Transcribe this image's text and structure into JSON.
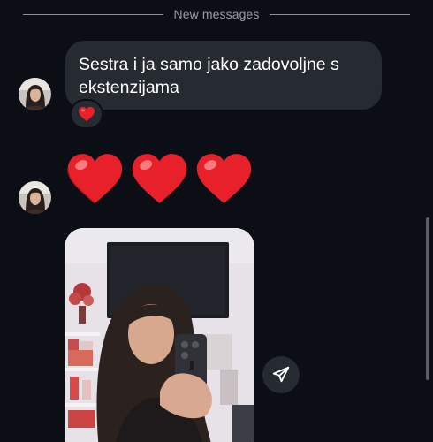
{
  "divider": {
    "label": "New messages"
  },
  "messages": [
    {
      "type": "text",
      "text": "Sestra i ja samo jako zadovoljne  s ekstenzijama",
      "reaction": "heart-emoji"
    },
    {
      "type": "emoji",
      "emojis": [
        "heart-emoji",
        "heart-emoji",
        "heart-emoji"
      ]
    },
    {
      "type": "photo",
      "description_icon": "photo-attachment"
    }
  ],
  "colors": {
    "background": "#0b0e14",
    "bubble": "#262a31",
    "text": "#ffffff",
    "muted": "#9a9ca3",
    "heart": "#e8202a"
  }
}
